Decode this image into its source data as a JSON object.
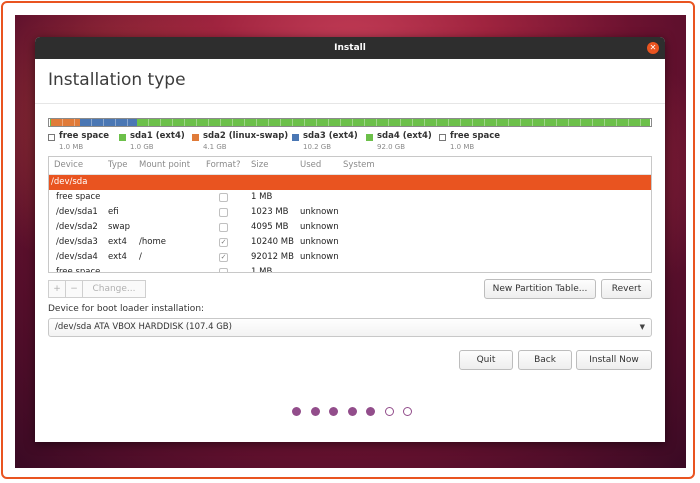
{
  "window": {
    "title": "Install"
  },
  "page_title": "Installation type",
  "colors": {
    "accent": "#e95420",
    "free": "#ffffff",
    "sda1": "#6cc04a",
    "sda2": "#e07b39",
    "sda3": "#4a77b4",
    "sda4": "#6cc04a",
    "step_dot": "#924d8b"
  },
  "partition_bar": [
    {
      "key": "free",
      "fraction": 0.001
    },
    {
      "key": "sda1",
      "fraction": 0.0009
    },
    {
      "key": "sda2",
      "fraction": 0.038
    },
    {
      "key": "sda3",
      "fraction": 0.095
    },
    {
      "key": "sda4",
      "fraction": 0.857
    },
    {
      "key": "free2",
      "fraction": 0.001
    }
  ],
  "legend": [
    {
      "name": "free space",
      "size": "1.0 MB",
      "color": "#ffffff"
    },
    {
      "name": "sda1 (ext4)",
      "size": "1.0 GB",
      "color": "#6cc04a"
    },
    {
      "name": "sda2 (linux-swap)",
      "size": "4.1 GB",
      "color": "#e07b39"
    },
    {
      "name": "sda3 (ext4)",
      "size": "10.2 GB",
      "color": "#4a77b4"
    },
    {
      "name": "sda4 (ext4)",
      "size": "92.0 GB",
      "color": "#6cc04a"
    },
    {
      "name": "free space",
      "size": "1.0 MB",
      "color": "#ffffff"
    }
  ],
  "table": {
    "headers": [
      "Device",
      "Type",
      "Mount point",
      "Format?",
      "Size",
      "Used",
      "System"
    ],
    "rows": [
      {
        "device": "/dev/sda",
        "type": "",
        "mount": "",
        "format": null,
        "size": "",
        "used": "",
        "system": "",
        "selected": true
      },
      {
        "device": "free space",
        "type": "",
        "mount": "",
        "format": false,
        "size": "1 MB",
        "used": "",
        "system": ""
      },
      {
        "device": "/dev/sda1",
        "type": "efi",
        "mount": "",
        "format": false,
        "size": "1023 MB",
        "used": "unknown",
        "system": ""
      },
      {
        "device": "/dev/sda2",
        "type": "swap",
        "mount": "",
        "format": false,
        "size": "4095 MB",
        "used": "unknown",
        "system": ""
      },
      {
        "device": "/dev/sda3",
        "type": "ext4",
        "mount": "/home",
        "format": true,
        "size": "10240 MB",
        "used": "unknown",
        "system": ""
      },
      {
        "device": "/dev/sda4",
        "type": "ext4",
        "mount": "/",
        "format": true,
        "size": "92012 MB",
        "used": "unknown",
        "system": ""
      },
      {
        "device": "free space",
        "type": "",
        "mount": "",
        "format": false,
        "size": "1 MB",
        "used": "",
        "system": ""
      }
    ]
  },
  "toolbar": {
    "add": "+",
    "remove": "−",
    "change": "Change..."
  },
  "buttons": {
    "new_partition_table": "New Partition Table...",
    "revert": "Revert",
    "quit": "Quit",
    "back": "Back",
    "install_now": "Install Now"
  },
  "bootloader": {
    "label": "Device for boot loader installation:",
    "value": "/dev/sda   ATA VBOX HARDDISK (107.4 GB)"
  },
  "progress": {
    "total_steps": 7,
    "completed_steps": 5
  }
}
